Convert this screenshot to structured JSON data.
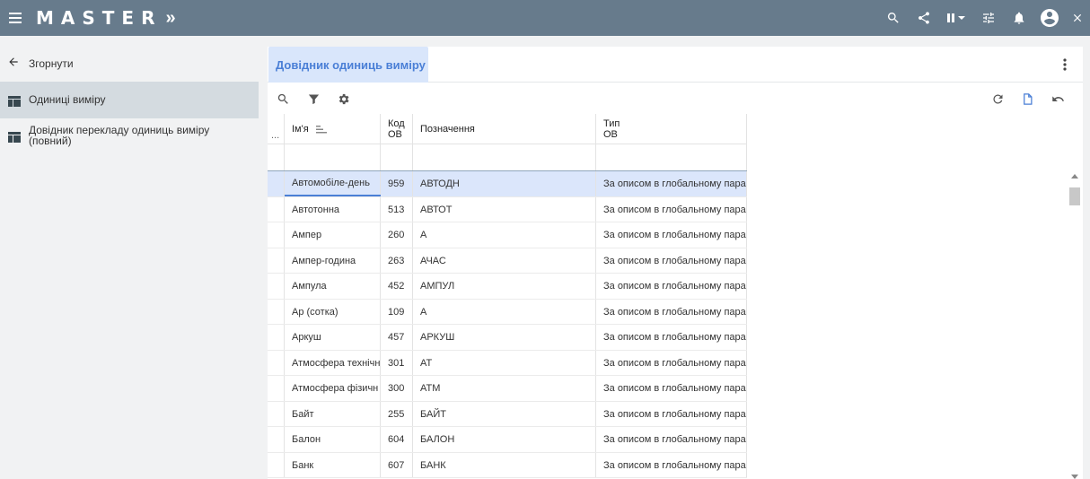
{
  "app": {
    "title": "MASTER",
    "chevron": "»"
  },
  "topbar": {
    "icons": [
      "search-icon",
      "share-icon",
      "pause-dropdown-icon",
      "filter-list-icon",
      "bell-icon",
      "account-icon",
      "close-icon"
    ]
  },
  "sidebar": {
    "collapse_label": "Згорнути",
    "items": [
      {
        "label": "Одиниці виміру",
        "active": true
      },
      {
        "label": "Довідник перекладу одиниць виміру (повний)",
        "active": false
      }
    ]
  },
  "panel": {
    "tab_label": "Довідник одиниць виміру"
  },
  "table": {
    "row_menu": "...",
    "columns": [
      {
        "label": "Ім'я"
      },
      {
        "label_line1": "Код",
        "label_line2": "ОВ"
      },
      {
        "label": "Позначення"
      },
      {
        "label_line1": "Тип",
        "label_line2": "ОВ"
      }
    ],
    "rows": [
      [
        "Автомобіле-день",
        "959",
        "АВТОДН",
        "За описом в глобальному пара"
      ],
      [
        "Автотонна",
        "513",
        "АВТОТ",
        "За описом в глобальному пара"
      ],
      [
        "Ампер",
        "260",
        "А",
        "За описом в глобальному пара"
      ],
      [
        "Ампер-година",
        "263",
        "АЧАС",
        "За описом в глобальному пара"
      ],
      [
        "Ампула",
        "452",
        "АМПУЛ",
        "За описом в глобальному пара"
      ],
      [
        "Ар (сотка)",
        "109",
        "А",
        "За описом в глобальному пара"
      ],
      [
        "Аркуш",
        "457",
        "АРКУШ",
        "За описом в глобальному пара"
      ],
      [
        "Атмосфера технічн",
        "301",
        "АТ",
        "За описом в глобальному пара"
      ],
      [
        "Атмосфера фізичн",
        "300",
        "АТМ",
        "За описом в глобальному пара"
      ],
      [
        "Байт",
        "255",
        "БАЙТ",
        "За описом в глобальному пара"
      ],
      [
        "Балон",
        "604",
        "БАЛОН",
        "За описом в глобальному пара"
      ],
      [
        "Банк",
        "607",
        "БАНК",
        "За описом в глобальному пара"
      ]
    ]
  },
  "colors": {
    "topbar": "#677b8c",
    "accent": "#4a7fd6",
    "selected_row": "#dbe6fb"
  }
}
